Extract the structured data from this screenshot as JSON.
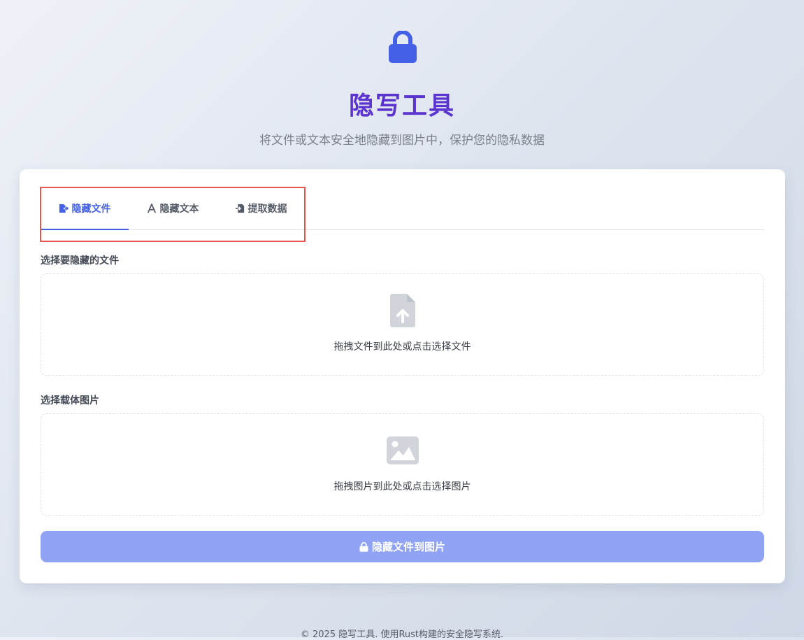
{
  "header": {
    "icon": "lock-icon",
    "title": "隐写工具",
    "subtitle": "将文件或文本安全地隐藏到图片中，保护您的隐私数据",
    "accent_color": "#5b34d0",
    "icon_color": "#4460e6"
  },
  "tabs": [
    {
      "label": "隐藏文件",
      "icon": "file-export-icon",
      "active": true
    },
    {
      "label": "隐藏文本",
      "icon": "font-icon",
      "active": false
    },
    {
      "label": "提取数据",
      "icon": "file-import-icon",
      "active": false
    }
  ],
  "file_section": {
    "label": "选择要隐藏的文件",
    "dropzone_icon": "file-upload-icon",
    "dropzone_text": "拖拽文件到此处或点击选择文件"
  },
  "image_section": {
    "label": "选择载体图片",
    "dropzone_icon": "image-icon",
    "dropzone_text": "拖拽图片到此处或点击选择图片"
  },
  "submit": {
    "icon": "lock-icon",
    "label": "隐藏文件到图片",
    "color": "#8fa2f4"
  },
  "footer": {
    "text": "© 2025 隐写工具. 使用Rust构建的安全隐写系统."
  }
}
